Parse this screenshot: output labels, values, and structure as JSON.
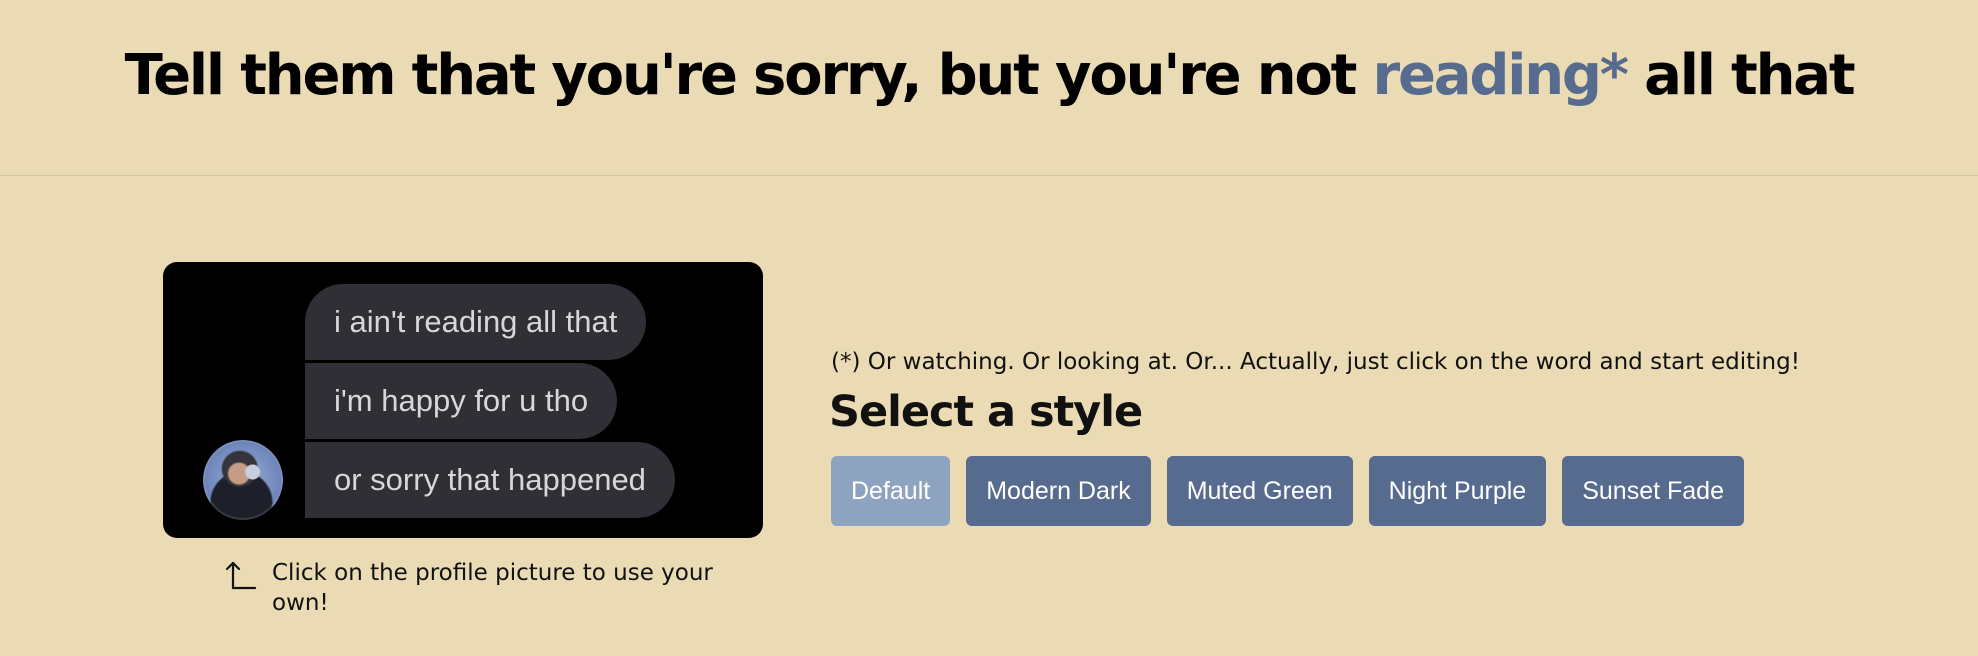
{
  "header": {
    "title_prefix": "Tell them that you're sorry, but you're not",
    "title_editable": "reading*",
    "title_suffix": "all that"
  },
  "preview": {
    "messages": [
      "i ain't reading all that",
      "i'm happy for u tho",
      "or sorry that happened"
    ],
    "avatar_icon": "profile-picture"
  },
  "hint": {
    "icon": "turn-up-left-arrow-icon",
    "text": "Click on the profile picture to use your own!"
  },
  "footnote": "(*) Or watching. Or looking at. Or... Actually, just click on the word and start editing!",
  "styles": {
    "heading": "Select a style",
    "options": [
      "Default",
      "Modern Dark",
      "Muted Green",
      "Night Purple",
      "Sunset Fade"
    ],
    "selected": "Default"
  },
  "colors": {
    "background": "#eadbb4",
    "accent": "#576b8f",
    "selected_button": "#8ea3bf",
    "bubble": "#2f2f35"
  }
}
